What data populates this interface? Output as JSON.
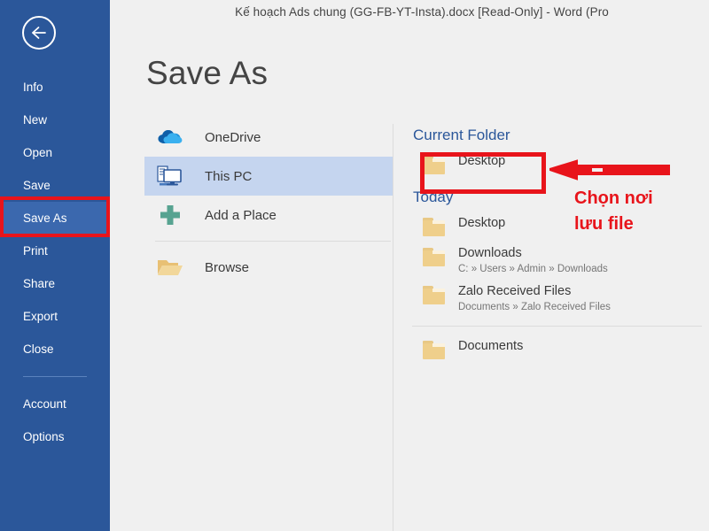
{
  "window": {
    "title": "Kế hoạch Ads chung (GG-FB-YT-Insta).docx [Read-Only] - Word (Pro"
  },
  "sidebar": {
    "back_icon": "back-arrow-icon",
    "accent_color": "#2b579a",
    "selected_color": "#3b68ae",
    "items": [
      {
        "label": "Info"
      },
      {
        "label": "New"
      },
      {
        "label": "Open"
      },
      {
        "label": "Save"
      },
      {
        "label": "Save As"
      },
      {
        "label": "Print"
      },
      {
        "label": "Share"
      },
      {
        "label": "Export"
      },
      {
        "label": "Close"
      },
      {
        "label": "Account"
      },
      {
        "label": "Options"
      }
    ],
    "selected": "Save As"
  },
  "main": {
    "page_title": "Save As",
    "places": [
      {
        "label": "OneDrive",
        "icon": "onedrive-cloud-icon",
        "selected": false
      },
      {
        "label": "This PC",
        "icon": "this-pc-monitor-icon",
        "selected": true
      },
      {
        "label": "Add a Place",
        "icon": "plus-icon",
        "selected": false
      },
      {
        "label": "Browse",
        "icon": "open-folder-icon",
        "selected": false
      }
    ]
  },
  "folders": {
    "current_folder_heading": "Current Folder",
    "current_folder": [
      {
        "name": "Desktop",
        "path": ""
      }
    ],
    "today_heading": "Today",
    "today": [
      {
        "name": "Desktop",
        "path": ""
      },
      {
        "name": "Downloads",
        "path": "C: » Users » Admin » Downloads"
      },
      {
        "name": "Zalo Received Files",
        "path": "Documents » Zalo Received Files"
      }
    ],
    "older": [
      {
        "name": "Documents",
        "path": ""
      }
    ]
  },
  "annotations": {
    "color": "#e8141b",
    "callout_line1": "Chọn nơi",
    "callout_line2": "lưu file",
    "arrow_icon": "left-arrow-annotation",
    "highlight_saveas": "save-as-highlight-box",
    "highlight_desktop": "desktop-highlight-box"
  }
}
